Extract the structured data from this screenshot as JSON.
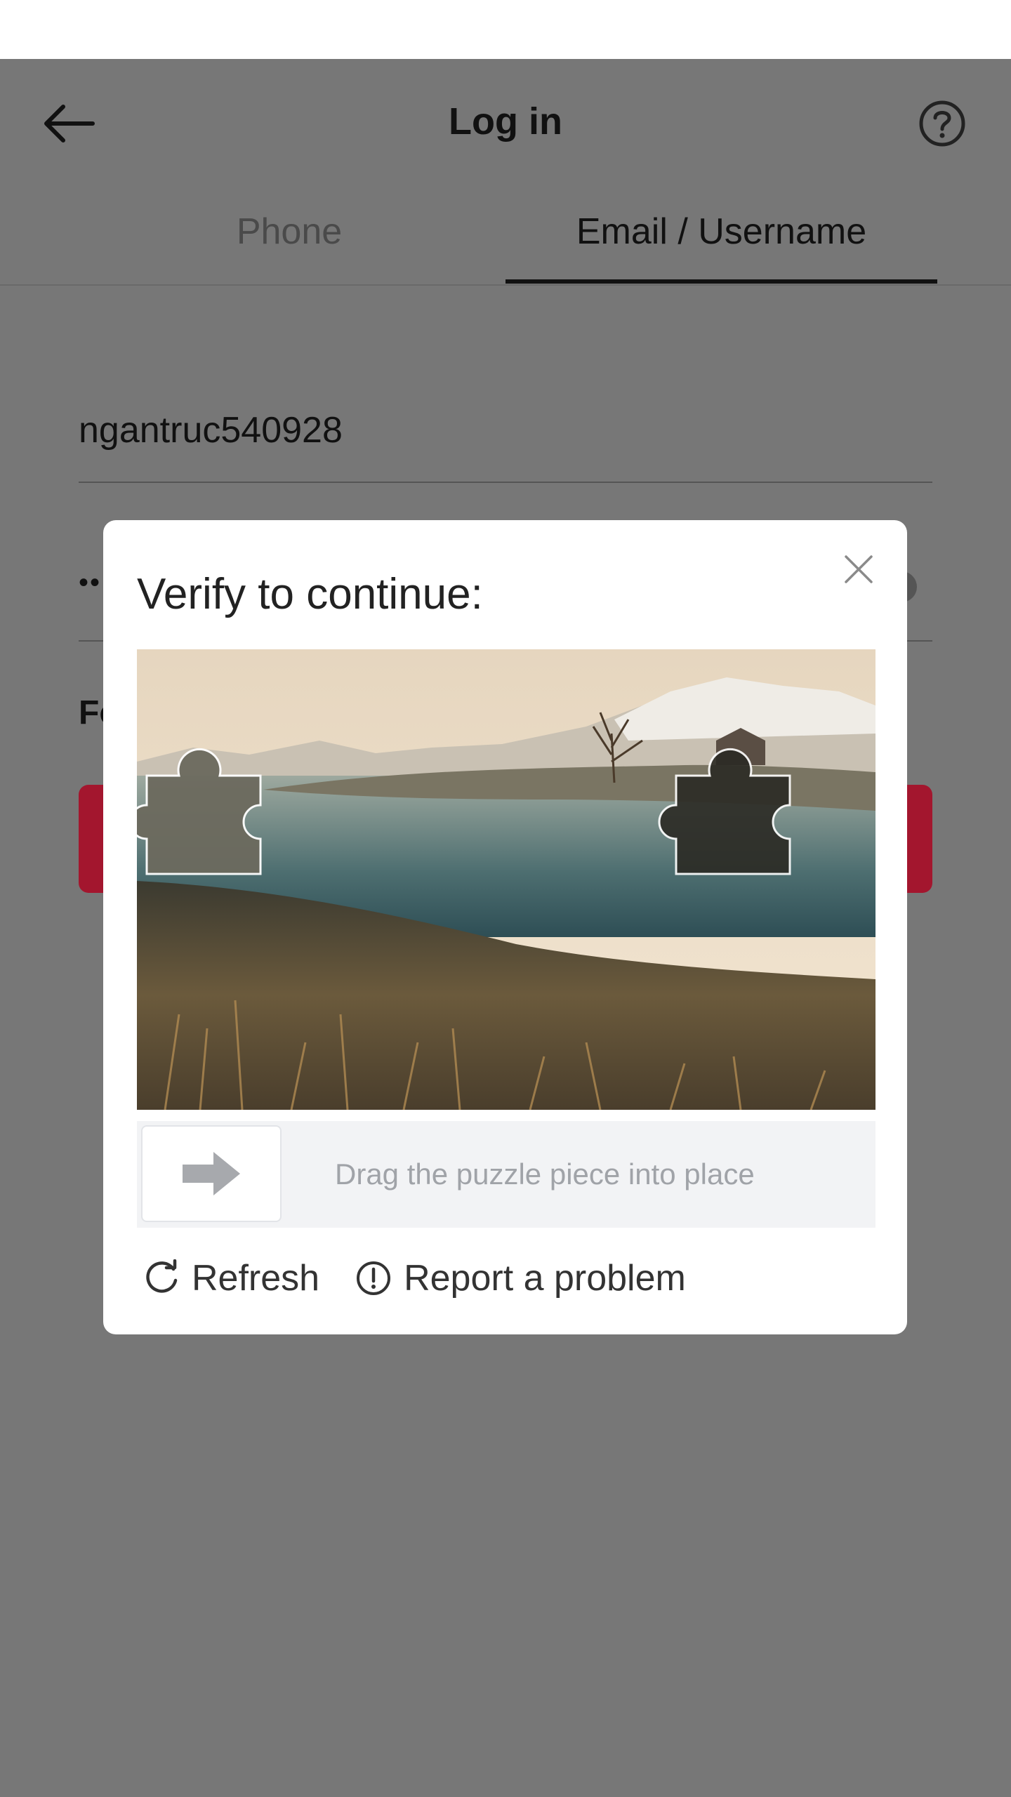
{
  "header": {
    "title": "Log in",
    "back_icon": "arrow-left-icon",
    "help_icon": "question-circle-icon"
  },
  "tabs": [
    {
      "label": "Phone",
      "selected": false
    },
    {
      "label": "Email / Username",
      "selected": true
    }
  ],
  "form": {
    "username_value": "ngantruc540928",
    "password_value": "••",
    "forgot_link_partial": "Fo",
    "primary_button_color": "#a3162e"
  },
  "captcha": {
    "title": "Verify to continue:",
    "close_icon": "close-icon",
    "slider_hint": "Drag the puzzle piece into place",
    "slider_icon": "arrow-right-icon",
    "refresh_label": "Refresh",
    "refresh_icon": "refresh-icon",
    "report_label": "Report a problem",
    "report_icon": "alert-circle-icon"
  }
}
